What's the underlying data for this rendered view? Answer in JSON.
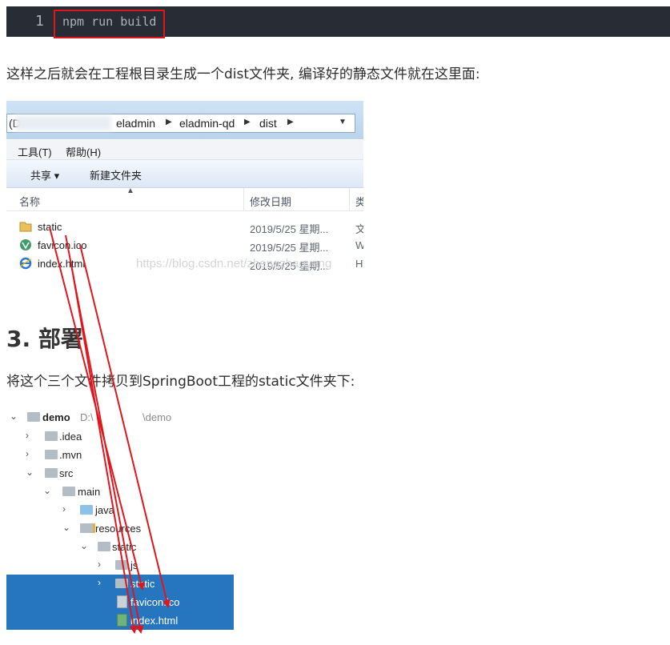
{
  "code_block": {
    "line_number": "1",
    "command": "npm run build"
  },
  "para1": "这样之后就会在工程根目录生成一个dist文件夹, 编译好的静态文件就在这里面:",
  "explorer": {
    "address": {
      "prefix": "(D",
      "segments": [
        "eladmin",
        "eladmin-qd",
        "dist"
      ]
    },
    "menu": [
      "工具(T)",
      "帮助(H)"
    ],
    "commands": [
      "共享 ▾",
      "新建文件夹"
    ],
    "columns": [
      "名称",
      "修改日期",
      "类"
    ],
    "files": [
      {
        "name": "static",
        "date": "2019/5/25 星期...",
        "type": "文"
      },
      {
        "name": "favicon.ico",
        "date": "2019/5/25 星期...",
        "type": "W"
      },
      {
        "name": "index.html",
        "date": "2019/5/25 星期...",
        "type": "HT"
      }
    ],
    "watermark": "https://blog.csdn.net/zhengzhaoyang"
  },
  "heading": "3. 部署",
  "para2": "将这个三个文件拷贝到SpringBoot工程的static文件夹下:",
  "tree": {
    "root": {
      "name": "demo",
      "path": "D:\\",
      "path_end": "\\demo"
    },
    "items": [
      ".idea",
      ".mvn",
      "src",
      "main",
      "java",
      "resources",
      "static",
      "js",
      "static",
      "favicon.ico",
      "index.html"
    ]
  },
  "colors": {
    "code_bg": "#282c34",
    "highlight": "#e0161d",
    "arrow": "#e0161d",
    "selection": "#2675bf"
  }
}
